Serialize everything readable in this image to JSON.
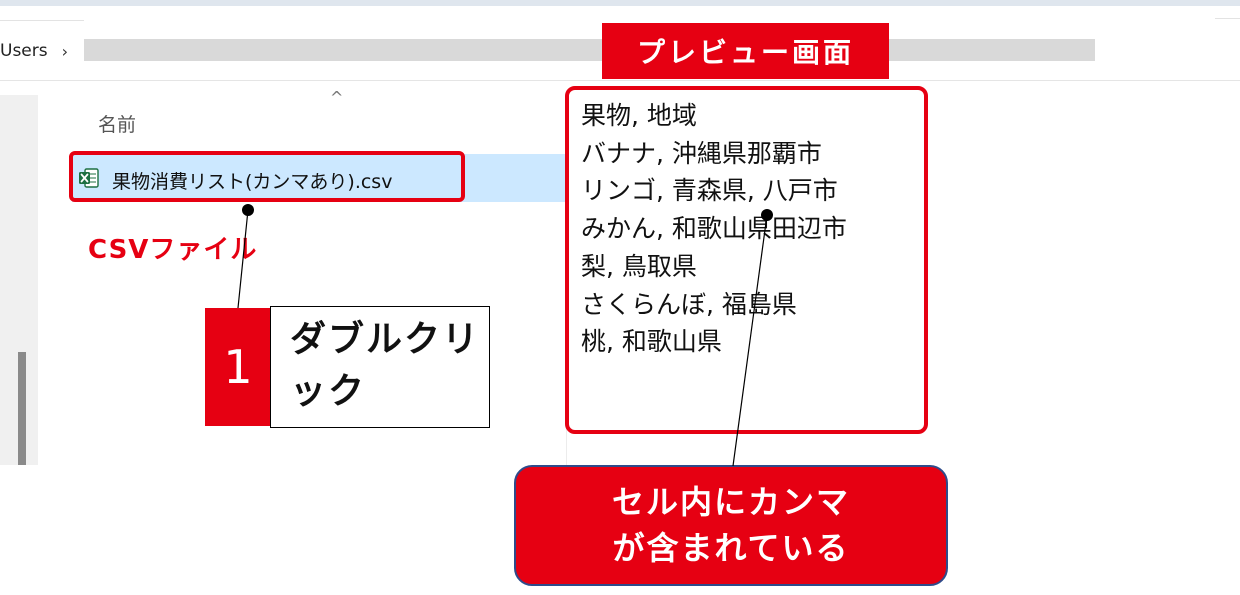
{
  "explorer": {
    "breadcrumb": "Users",
    "breadcrumb_chevron": "›",
    "sort_indicator": "^",
    "column_header": "名前",
    "file": {
      "name": "果物消費リスト(カンマあり).csv",
      "icon": "excel-csv-icon"
    }
  },
  "annotations": {
    "csv_label": "CSVファイル",
    "step_number": "1",
    "step_text": "ダブルクリック",
    "preview_title": "プレビュー画面",
    "callout_line1": "セル内にカンマ",
    "callout_line2": "が含まれている"
  },
  "preview": {
    "lines": [
      "果物, 地域",
      "バナナ, 沖縄県那覇市",
      "リンゴ, 青森県, 八戸市",
      "みかん, 和歌山県田辺市",
      "梨, 鳥取県",
      "さくらんぼ, 福島県",
      "桃, 和歌山県"
    ]
  },
  "colors": {
    "accent_red": "#e60012",
    "selection_blue": "#cce8ff",
    "excel_green": "#1d6f42",
    "callout_border": "#2f4b8a"
  }
}
